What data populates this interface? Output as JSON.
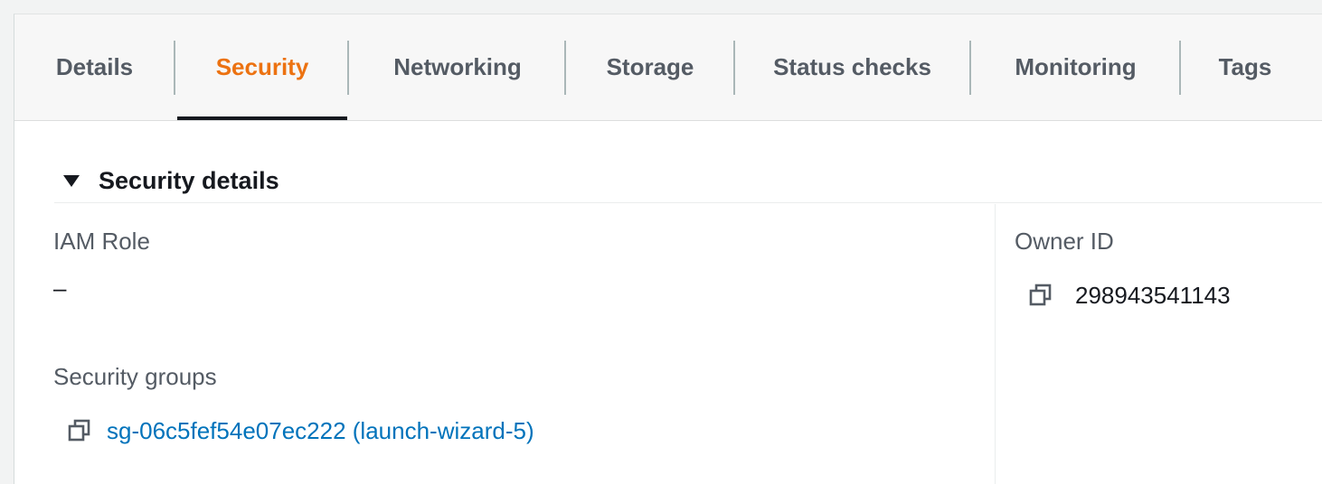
{
  "tabs": [
    {
      "label": "Details",
      "active": false
    },
    {
      "label": "Security",
      "active": true
    },
    {
      "label": "Networking",
      "active": false
    },
    {
      "label": "Storage",
      "active": false
    },
    {
      "label": "Status checks",
      "active": false
    },
    {
      "label": "Monitoring",
      "active": false
    },
    {
      "label": "Tags",
      "active": false
    }
  ],
  "colors": {
    "active_tab": "#ec7211",
    "link": "#0073bb",
    "text": "#16191f",
    "muted_text": "#545b64"
  },
  "section": {
    "title": "Security details",
    "expanded": true,
    "toggle_icon": "caret-down-icon"
  },
  "iam_role": {
    "label": "IAM Role",
    "value": "–"
  },
  "security_groups": {
    "label": "Security groups",
    "value": "sg-06c5fef54e07ec222 (launch-wizard-5)",
    "icon": "copy-icon"
  },
  "owner_id": {
    "label": "Owner ID",
    "value": "298943541143",
    "icon": "copy-icon"
  }
}
